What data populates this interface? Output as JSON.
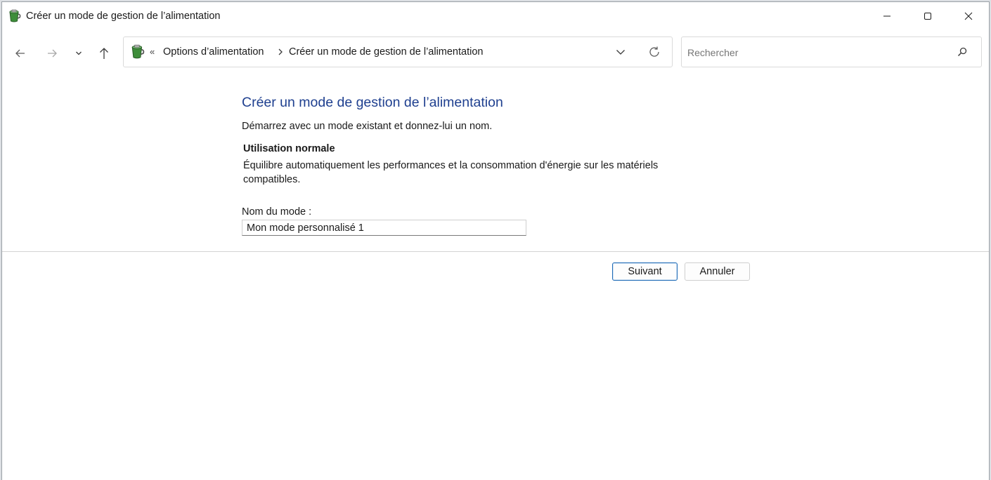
{
  "window": {
    "title": "Créer un mode de gestion de l’alimentation",
    "controls": {
      "minimize": "minimize-icon",
      "maximize": "maximize-icon",
      "close": "close-icon"
    }
  },
  "nav": {
    "back": "back-arrow-icon",
    "forward": "forward-arrow-icon",
    "recent": "chevron-down-icon",
    "up": "up-arrow-icon"
  },
  "address": {
    "overflow": "«",
    "crumbs": [
      "Options d’alimentation",
      "Créer un mode de gestion de l’alimentation"
    ]
  },
  "search": {
    "placeholder": "Rechercher",
    "value": ""
  },
  "content": {
    "heading": "Créer un mode de gestion de l’alimentation",
    "subtitle": "Démarrez avec un mode existant et donnez-lui un nom.",
    "plan": {
      "name": "Utilisation normale",
      "description": "Équilibre automatiquement les performances et la consommation d'énergie sur les matériels compatibles."
    },
    "field": {
      "label": "Nom du mode :",
      "value": "Mon mode personnalisé 1"
    }
  },
  "buttons": {
    "next": "Suivant",
    "cancel": "Annuler"
  },
  "colors": {
    "heading": "#1e3f8f",
    "primary_border": "#1f6bb6"
  }
}
